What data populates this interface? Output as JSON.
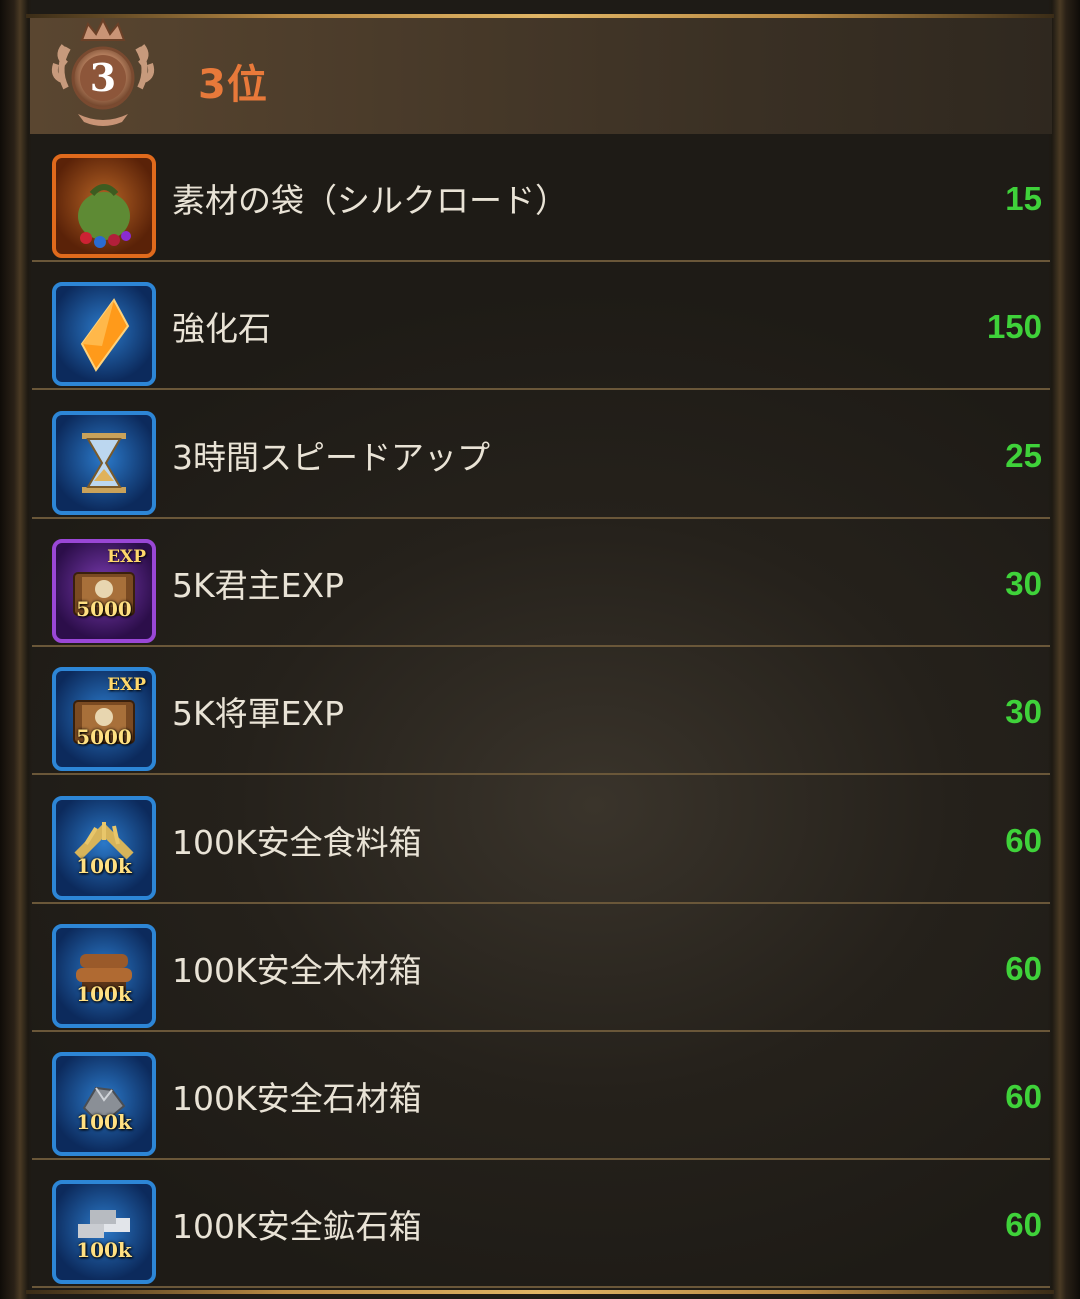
{
  "rank": {
    "number": "3",
    "label": "3位"
  },
  "colors": {
    "rank_label": "#e8793a",
    "quantity": "#3fd23a",
    "item_text": "#e9e3d6"
  },
  "items": [
    {
      "name": "素材の袋（シルクロード）",
      "qty": "15",
      "icon": "material-bag-icon",
      "frame": "orange",
      "tag": ""
    },
    {
      "name": "強化石",
      "qty": "150",
      "icon": "enhancement-stone-icon",
      "frame": "blue",
      "tag": ""
    },
    {
      "name": "3時間スピードアップ",
      "qty": "25",
      "icon": "hourglass-icon",
      "frame": "blue",
      "tag": ""
    },
    {
      "name": "5K君主EXP",
      "qty": "30",
      "icon": "exp-book-icon",
      "frame": "purple",
      "tag": "5000",
      "exp": "EXP"
    },
    {
      "name": "5K将軍EXP",
      "qty": "30",
      "icon": "exp-book-icon",
      "frame": "blue",
      "tag": "5000",
      "exp": "EXP"
    },
    {
      "name": "100K安全食料箱",
      "qty": "60",
      "icon": "food-crate-icon",
      "frame": "blue",
      "tag": "100k"
    },
    {
      "name": "100K安全木材箱",
      "qty": "60",
      "icon": "wood-crate-icon",
      "frame": "blue",
      "tag": "100k"
    },
    {
      "name": "100K安全石材箱",
      "qty": "60",
      "icon": "stone-crate-icon",
      "frame": "blue",
      "tag": "100k"
    },
    {
      "name": "100K安全鉱石箱",
      "qty": "60",
      "icon": "ore-crate-icon",
      "frame": "blue",
      "tag": "100k"
    }
  ]
}
